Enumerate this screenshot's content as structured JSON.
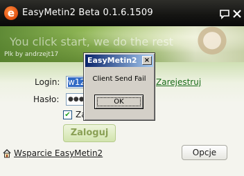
{
  "window": {
    "title": "EasyMetin2 Beta 0.1.6.1509",
    "logo_letter": "e",
    "buttons": {
      "chat_icon": "speech-bubble-icon",
      "close_icon": "close-icon"
    }
  },
  "banner": {
    "slogan": "You click start, we do the rest",
    "credit": "Plk by andrzejt17"
  },
  "form": {
    "login_label": "Login:",
    "login_value": "w12",
    "password_label": "Hasło:",
    "password_value": "●●●",
    "register_link": "Zarejestruj",
    "remember_checked": true,
    "remember_label": "Za",
    "login_button": "Zaloguj"
  },
  "footer": {
    "support_link": "Wsparcie EasyMetin2",
    "options_button": "Opcje"
  },
  "dialog": {
    "title": "EasyMetin2",
    "message": "Client Send Fail",
    "ok_button": "OK",
    "close_label": "×"
  },
  "colors": {
    "titlebar": "#141412",
    "dialog_title_start": "#0a246a",
    "link_green": "#1a6b1a"
  }
}
